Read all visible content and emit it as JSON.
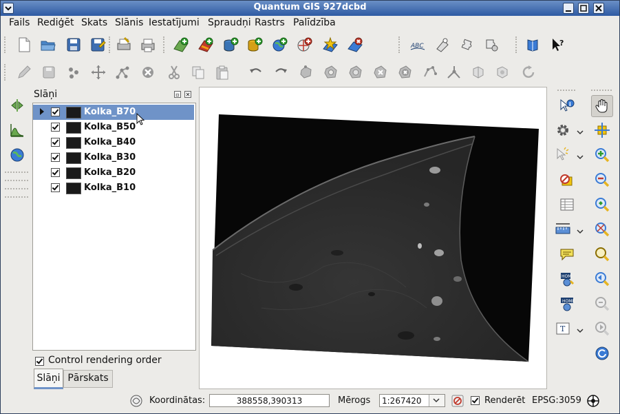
{
  "window": {
    "title": "Quantum GIS 927dcbd"
  },
  "menu": [
    "Fails",
    "Rediģēt",
    "Skats",
    "Slānis",
    "Iestatījumi",
    "Spraudņi",
    "Rastrs",
    "Palīdzība"
  ],
  "file_toolbar": [
    "new-project-icon",
    "open-project-icon",
    "save-project-icon",
    "save-as-icon",
    "print-composer-icon",
    "print-icon",
    "add-vector-layer-icon",
    "add-raster-layer-icon",
    "add-postgis-layer-icon",
    "add-spatialite-layer-icon",
    "add-wms-layer-icon",
    "add-wfs-layer-icon",
    "new-vector-layer-icon",
    "remove-layer-icon",
    "label-icon",
    "georeferencer-icon",
    "plugin-manager-icon",
    "plugin-settings-icon",
    "help-contents-icon",
    "whats-this-icon"
  ],
  "edit_toolbar": [
    "toggle-editing-icon",
    "save-edits-icon",
    "add-feature-icon",
    "move-feature-icon",
    "node-tool-icon",
    "delete-selected-icon",
    "cut-features-icon",
    "copy-features-icon",
    "paste-features-icon",
    "undo-icon",
    "redo-icon",
    "simplify-feature-icon",
    "add-ring-icon",
    "add-part-icon",
    "delete-ring-icon",
    "delete-part-icon",
    "reshape-features-icon",
    "split-features-icon",
    "merge-features-icon",
    "merge-attributes-icon",
    "rotate-symbols-icon"
  ],
  "layers_panel": {
    "title": "Slāņi",
    "layers": [
      {
        "name": "Kolka_B70",
        "checked": true,
        "selected": true
      },
      {
        "name": "Kolka_B50",
        "checked": true,
        "selected": false
      },
      {
        "name": "Kolka_B40",
        "checked": true,
        "selected": false
      },
      {
        "name": "Kolka_B30",
        "checked": true,
        "selected": false
      },
      {
        "name": "Kolka_B20",
        "checked": true,
        "selected": false
      },
      {
        "name": "Kolka_B10",
        "checked": true,
        "selected": false
      }
    ],
    "control_rendering_order": {
      "label": "Control rendering order",
      "checked": true
    },
    "tabs": [
      "Slāņi",
      "Pārskats"
    ],
    "active_tab": "Slāņi"
  },
  "left_tools": [
    "toggle-overview-icon",
    "histogram-icon",
    "globe-icon"
  ],
  "right_tools": {
    "left_column": [
      "identify-icon",
      "settings-gear-icon",
      "select-features-icon",
      "no-select-icon",
      "attribute-table-icon",
      "measure-icon",
      "annotation-icon",
      "home-up-icon",
      "home-icon",
      "text-annotation-icon"
    ],
    "right_column": [
      "pan-icon",
      "pan-to-selected-icon",
      "zoom-in-icon",
      "zoom-out-icon",
      "zoom-full-icon",
      "zoom-to-selection-icon",
      "zoom-to-layer-icon",
      "zoom-last-icon",
      "zoom-next-icon",
      "refresh-icon"
    ]
  },
  "statusbar": {
    "coords_label": "Koordinātas:",
    "coords_value": "388558,390313",
    "scale_label": "Mērogs",
    "scale_value": "1:267420",
    "render_label": "Renderēt",
    "render_checked": true,
    "crs": "EPSG:3059"
  },
  "colors": {
    "title_bar": "#2e5aa3",
    "selection": "#6f93c8",
    "map_background": "#ffffff"
  }
}
